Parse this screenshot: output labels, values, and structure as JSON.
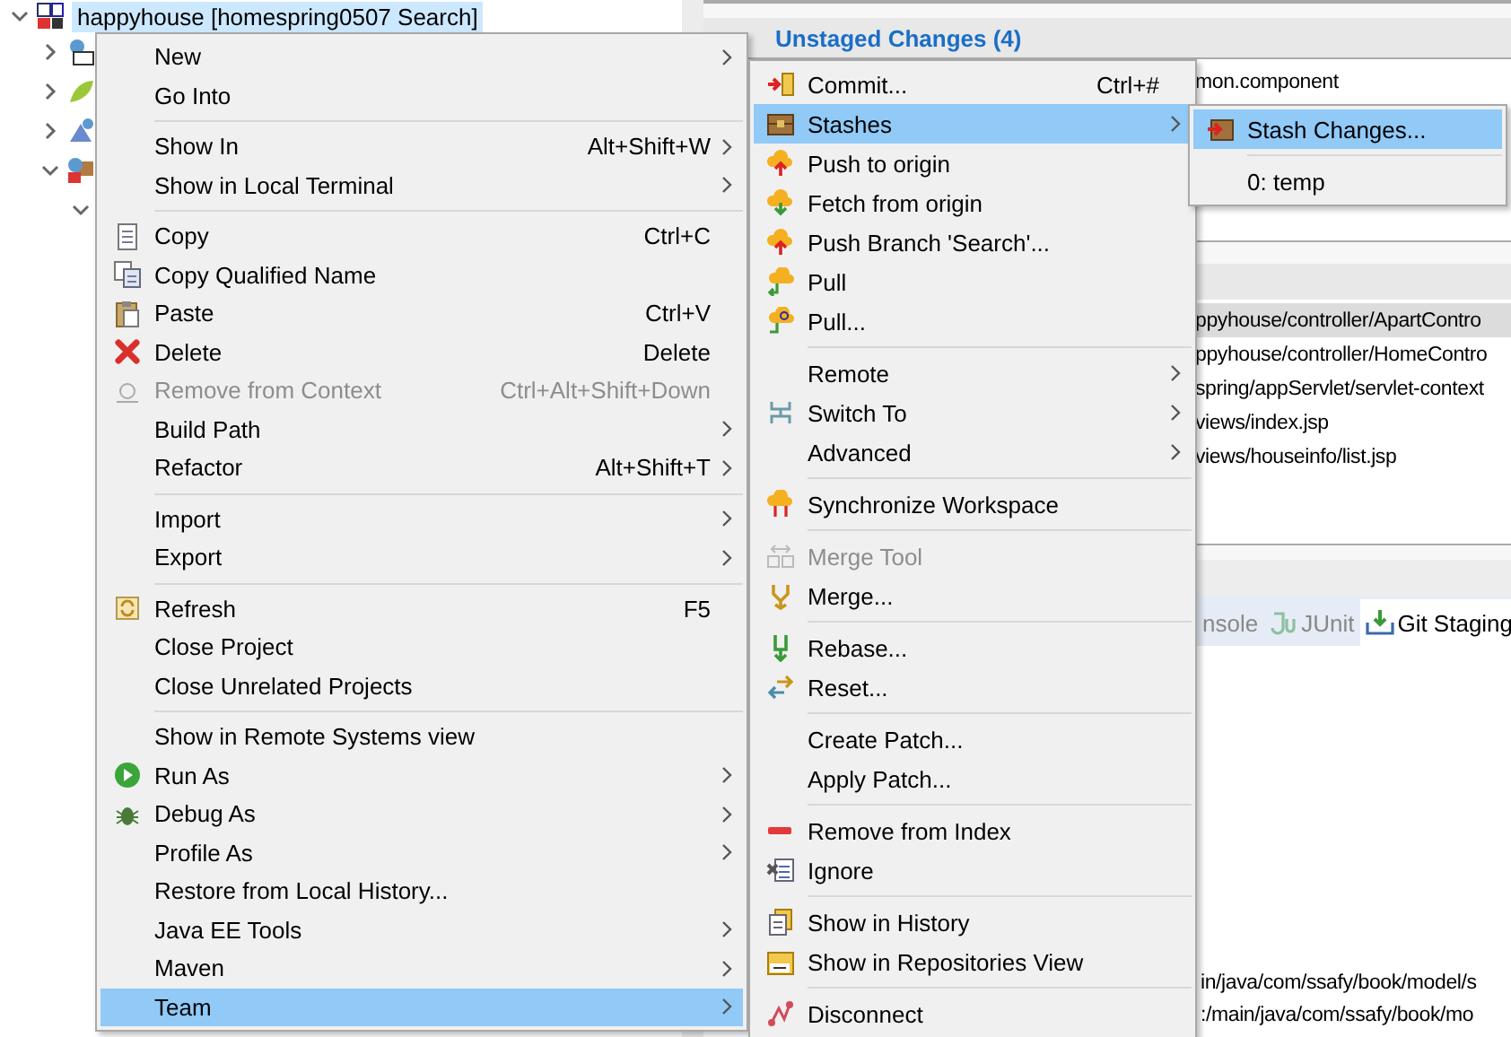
{
  "explorer": {
    "items": [
      {
        "label": "happyhouse [homespring0507 Search]",
        "selected": true,
        "expanded": true,
        "children": [
          {
            "expanded": false
          },
          {
            "expanded": false
          },
          {
            "expanded": false
          },
          {
            "expanded": true,
            "children": [
              {
                "expanded": true
              }
            ]
          }
        ]
      }
    ]
  },
  "git_staging": {
    "unstaged": {
      "title": "Unstaged Changes (4)",
      "files": [
        "mon.component"
      ]
    },
    "staged": {
      "files": [
        {
          "path": "ppyhouse/controller/ApartContro",
          "selected": true
        },
        {
          "path": "ppyhouse/controller/HomeContro",
          "selected": false
        },
        {
          "path": "spring/appServlet/servlet-context",
          "selected": false
        },
        {
          "path": "views/index.jsp",
          "selected": false
        },
        {
          "path": "views/houseinfo/list.jsp",
          "selected": false
        }
      ]
    },
    "tabs": [
      {
        "label": "nsole",
        "selected": false
      },
      {
        "label": "JUnit",
        "selected": false
      },
      {
        "label": "Git Staging",
        "selected": true
      }
    ],
    "bottom_files": [
      "in/java/com/ssafy/book/model/s",
      ":/main/java/com/ssafy/book/mo"
    ]
  },
  "context_menu": {
    "items": [
      {
        "kind": "item",
        "label": "New",
        "submenu": true,
        "disabled": false,
        "selected": false
      },
      {
        "kind": "item",
        "label": "Go Into",
        "submenu": false,
        "disabled": false,
        "selected": false
      },
      {
        "kind": "separator"
      },
      {
        "kind": "item",
        "label": "Show In",
        "shortcut": "Alt+Shift+W",
        "submenu": true,
        "disabled": false,
        "selected": false
      },
      {
        "kind": "item",
        "label": "Show in Local Terminal",
        "submenu": true,
        "disabled": false,
        "selected": false
      },
      {
        "kind": "separator"
      },
      {
        "kind": "item",
        "label": "Copy",
        "shortcut": "Ctrl+C",
        "submenu": false,
        "disabled": false,
        "selected": false
      },
      {
        "kind": "item",
        "label": "Copy Qualified Name",
        "submenu": false,
        "disabled": false,
        "selected": false
      },
      {
        "kind": "item",
        "label": "Paste",
        "shortcut": "Ctrl+V",
        "submenu": false,
        "disabled": false,
        "selected": false
      },
      {
        "kind": "item",
        "label": "Delete",
        "shortcut": "Delete",
        "submenu": false,
        "disabled": false,
        "selected": false
      },
      {
        "kind": "item",
        "label": "Remove from Context",
        "shortcut": "Ctrl+Alt+Shift+Down",
        "submenu": false,
        "disabled": true,
        "selected": false
      },
      {
        "kind": "item",
        "label": "Build Path",
        "submenu": true,
        "disabled": false,
        "selected": false
      },
      {
        "kind": "item",
        "label": "Refactor",
        "shortcut": "Alt+Shift+T",
        "submenu": true,
        "disabled": false,
        "selected": false
      },
      {
        "kind": "separator"
      },
      {
        "kind": "item",
        "label": "Import",
        "submenu": true,
        "disabled": false,
        "selected": false
      },
      {
        "kind": "item",
        "label": "Export",
        "submenu": true,
        "disabled": false,
        "selected": false
      },
      {
        "kind": "separator"
      },
      {
        "kind": "item",
        "label": "Refresh",
        "shortcut": "F5",
        "submenu": false,
        "disabled": false,
        "selected": false
      },
      {
        "kind": "item",
        "label": "Close Project",
        "submenu": false,
        "disabled": false,
        "selected": false
      },
      {
        "kind": "item",
        "label": "Close Unrelated Projects",
        "submenu": false,
        "disabled": false,
        "selected": false
      },
      {
        "kind": "separator"
      },
      {
        "kind": "item",
        "label": "Show in Remote Systems view",
        "submenu": false,
        "disabled": false,
        "selected": false
      },
      {
        "kind": "item",
        "label": "Run As",
        "submenu": true,
        "disabled": false,
        "selected": false
      },
      {
        "kind": "item",
        "label": "Debug As",
        "submenu": true,
        "disabled": false,
        "selected": false
      },
      {
        "kind": "item",
        "label": "Profile As",
        "submenu": true,
        "disabled": false,
        "selected": false
      },
      {
        "kind": "item",
        "label": "Restore from Local History...",
        "submenu": false,
        "disabled": false,
        "selected": false
      },
      {
        "kind": "item",
        "label": "Java EE Tools",
        "submenu": true,
        "disabled": false,
        "selected": false
      },
      {
        "kind": "item",
        "label": "Maven",
        "submenu": true,
        "disabled": false,
        "selected": false
      },
      {
        "kind": "item",
        "label": "Team",
        "submenu": true,
        "disabled": false,
        "selected": true
      }
    ]
  },
  "team_menu": {
    "items": [
      {
        "kind": "item",
        "label": "Commit...",
        "shortcut": "Ctrl+#",
        "submenu": false,
        "disabled": false,
        "selected": false
      },
      {
        "kind": "item",
        "label": "Stashes",
        "submenu": true,
        "disabled": false,
        "selected": true
      },
      {
        "kind": "item",
        "label": "Push to origin",
        "submenu": false,
        "disabled": false,
        "selected": false
      },
      {
        "kind": "item",
        "label": "Fetch from origin",
        "submenu": false,
        "disabled": false,
        "selected": false
      },
      {
        "kind": "item",
        "label": "Push Branch 'Search'...",
        "submenu": false,
        "disabled": false,
        "selected": false
      },
      {
        "kind": "item",
        "label": "Pull",
        "submenu": false,
        "disabled": false,
        "selected": false
      },
      {
        "kind": "item",
        "label": "Pull...",
        "submenu": false,
        "disabled": false,
        "selected": false
      },
      {
        "kind": "separator"
      },
      {
        "kind": "item",
        "label": "Remote",
        "submenu": true,
        "disabled": false,
        "selected": false
      },
      {
        "kind": "item",
        "label": "Switch To",
        "submenu": true,
        "disabled": false,
        "selected": false
      },
      {
        "kind": "item",
        "label": "Advanced",
        "submenu": true,
        "disabled": false,
        "selected": false
      },
      {
        "kind": "separator"
      },
      {
        "kind": "item",
        "label": "Synchronize Workspace",
        "submenu": false,
        "disabled": false,
        "selected": false
      },
      {
        "kind": "separator"
      },
      {
        "kind": "item",
        "label": "Merge Tool",
        "submenu": false,
        "disabled": true,
        "selected": false
      },
      {
        "kind": "item",
        "label": "Merge...",
        "submenu": false,
        "disabled": false,
        "selected": false
      },
      {
        "kind": "separator"
      },
      {
        "kind": "item",
        "label": "Rebase...",
        "submenu": false,
        "disabled": false,
        "selected": false
      },
      {
        "kind": "item",
        "label": "Reset...",
        "submenu": false,
        "disabled": false,
        "selected": false
      },
      {
        "kind": "separator"
      },
      {
        "kind": "item",
        "label": "Create Patch...",
        "submenu": false,
        "disabled": false,
        "selected": false
      },
      {
        "kind": "item",
        "label": "Apply Patch...",
        "submenu": false,
        "disabled": false,
        "selected": false
      },
      {
        "kind": "separator"
      },
      {
        "kind": "item",
        "label": "Remove from Index",
        "submenu": false,
        "disabled": false,
        "selected": false
      },
      {
        "kind": "item",
        "label": "Ignore",
        "submenu": false,
        "disabled": false,
        "selected": false
      },
      {
        "kind": "separator"
      },
      {
        "kind": "item",
        "label": "Show in History",
        "submenu": false,
        "disabled": false,
        "selected": false
      },
      {
        "kind": "item",
        "label": "Show in Repositories View",
        "submenu": false,
        "disabled": false,
        "selected": false
      },
      {
        "kind": "separator"
      },
      {
        "kind": "item",
        "label": "Disconnect",
        "submenu": false,
        "disabled": false,
        "selected": false
      }
    ]
  },
  "stashes_menu": {
    "items": [
      {
        "kind": "item",
        "label": "Stash Changes...",
        "submenu": false,
        "disabled": false,
        "selected": true
      },
      {
        "kind": "separator"
      },
      {
        "kind": "item",
        "label": "0: temp",
        "submenu": false,
        "disabled": false,
        "selected": false
      }
    ]
  }
}
